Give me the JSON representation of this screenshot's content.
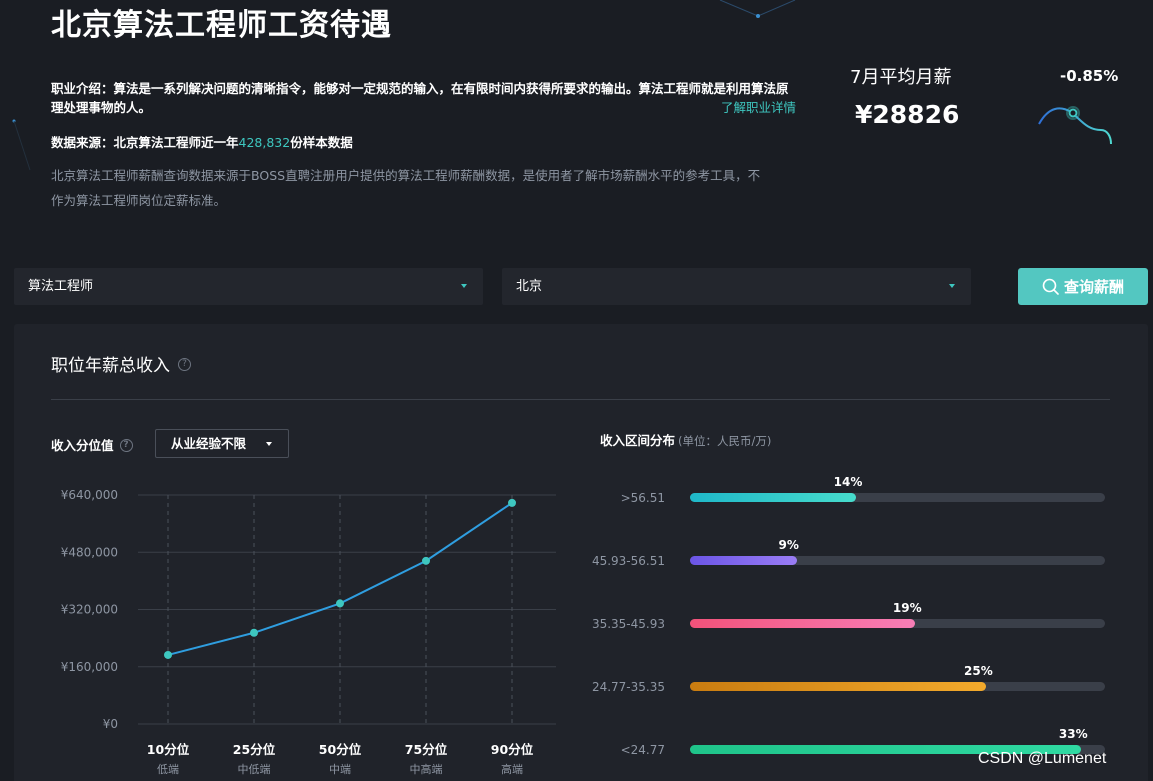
{
  "page_title": "北京算法工程师工资待遇",
  "intro": {
    "text": "职业介绍：算法是一系列解决问题的清晰指令，能够对一定规范的输入，在有限时间内获得所要求的输出。算法工程师就是利用算法原理处理事物的人。",
    "more_link": "了解职业详情"
  },
  "source": {
    "prefix": "数据来源：北京算法工程师近一年",
    "count": "428,832",
    "suffix": "份样本数据"
  },
  "description": "北京算法工程师薪酬查询数据来源于BOSS直聘注册用户提供的算法工程师薪酬数据，是使用者了解市场薪酬水平的参考工具，不作为算法工程师岗位定薪标准。",
  "monthly": {
    "label": "7月平均月薪",
    "value": "¥28826",
    "change": "-0.85%"
  },
  "search": {
    "job_value": "算法工程师",
    "city_value": "北京",
    "button_label": "查询薪酬"
  },
  "panel": {
    "title": "职位年薪总收入",
    "percentile_label": "收入分位值",
    "experience_select": "从业经验不限",
    "distribution_title": "收入区间分布",
    "distribution_unit": "(单位：人民币/万)"
  },
  "chart_data": [
    {
      "type": "line",
      "categories": [
        "10分位",
        "25分位",
        "50分位",
        "75分位",
        "90分位"
      ],
      "sub_labels": [
        "低端",
        "中低端",
        "中端",
        "中高端",
        "高端"
      ],
      "values": [
        193000,
        255000,
        337000,
        456000,
        618000
      ],
      "y_ticks": [
        "¥0",
        "¥160,000",
        "¥320,000",
        "¥480,000",
        "¥640,000"
      ],
      "ylim": [
        0,
        640000
      ],
      "grid": true,
      "line_color": "#2f9ee0",
      "point_color": "#3ec7c0"
    },
    {
      "type": "bar",
      "orientation": "horizontal",
      "categories": [
        ">56.51",
        "45.93-56.51",
        "35.35-45.93",
        "24.77-35.35",
        "<24.77"
      ],
      "values": [
        14,
        9,
        19,
        25,
        33
      ],
      "value_labels": [
        "14%",
        "9%",
        "19%",
        "25%",
        "33%"
      ],
      "colors": [
        [
          "#1fb8c9",
          "#47dccc"
        ],
        [
          "#6b55e6",
          "#9a7df5"
        ],
        [
          "#f2527a",
          "#f77eb6"
        ],
        [
          "#c97c10",
          "#f3aa2c"
        ],
        [
          "#1fc48a",
          "#2fd9a2"
        ]
      ],
      "xlim": [
        0,
        35
      ]
    }
  ],
  "watermark": "CSDN @Lumenet"
}
